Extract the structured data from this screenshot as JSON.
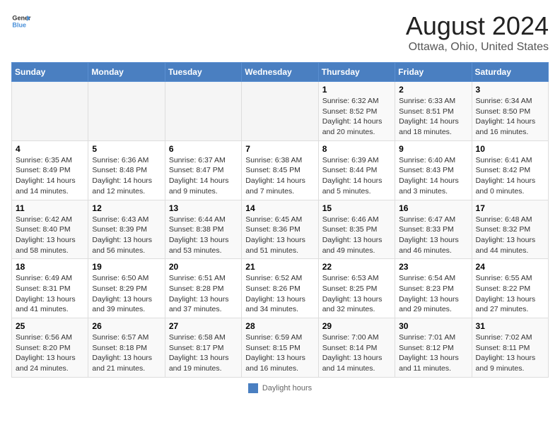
{
  "header": {
    "logo_line1": "General",
    "logo_line2": "Blue",
    "main_title": "August 2024",
    "subtitle": "Ottawa, Ohio, United States"
  },
  "days_of_week": [
    "Sunday",
    "Monday",
    "Tuesday",
    "Wednesday",
    "Thursday",
    "Friday",
    "Saturday"
  ],
  "weeks": [
    [
      {
        "date": "",
        "info": ""
      },
      {
        "date": "",
        "info": ""
      },
      {
        "date": "",
        "info": ""
      },
      {
        "date": "",
        "info": ""
      },
      {
        "date": "1",
        "info": "Sunrise: 6:32 AM\nSunset: 8:52 PM\nDaylight: 14 hours and 20 minutes."
      },
      {
        "date": "2",
        "info": "Sunrise: 6:33 AM\nSunset: 8:51 PM\nDaylight: 14 hours and 18 minutes."
      },
      {
        "date": "3",
        "info": "Sunrise: 6:34 AM\nSunset: 8:50 PM\nDaylight: 14 hours and 16 minutes."
      }
    ],
    [
      {
        "date": "4",
        "info": "Sunrise: 6:35 AM\nSunset: 8:49 PM\nDaylight: 14 hours and 14 minutes."
      },
      {
        "date": "5",
        "info": "Sunrise: 6:36 AM\nSunset: 8:48 PM\nDaylight: 14 hours and 12 minutes."
      },
      {
        "date": "6",
        "info": "Sunrise: 6:37 AM\nSunset: 8:47 PM\nDaylight: 14 hours and 9 minutes."
      },
      {
        "date": "7",
        "info": "Sunrise: 6:38 AM\nSunset: 8:45 PM\nDaylight: 14 hours and 7 minutes."
      },
      {
        "date": "8",
        "info": "Sunrise: 6:39 AM\nSunset: 8:44 PM\nDaylight: 14 hours and 5 minutes."
      },
      {
        "date": "9",
        "info": "Sunrise: 6:40 AM\nSunset: 8:43 PM\nDaylight: 14 hours and 3 minutes."
      },
      {
        "date": "10",
        "info": "Sunrise: 6:41 AM\nSunset: 8:42 PM\nDaylight: 14 hours and 0 minutes."
      }
    ],
    [
      {
        "date": "11",
        "info": "Sunrise: 6:42 AM\nSunset: 8:40 PM\nDaylight: 13 hours and 58 minutes."
      },
      {
        "date": "12",
        "info": "Sunrise: 6:43 AM\nSunset: 8:39 PM\nDaylight: 13 hours and 56 minutes."
      },
      {
        "date": "13",
        "info": "Sunrise: 6:44 AM\nSunset: 8:38 PM\nDaylight: 13 hours and 53 minutes."
      },
      {
        "date": "14",
        "info": "Sunrise: 6:45 AM\nSunset: 8:36 PM\nDaylight: 13 hours and 51 minutes."
      },
      {
        "date": "15",
        "info": "Sunrise: 6:46 AM\nSunset: 8:35 PM\nDaylight: 13 hours and 49 minutes."
      },
      {
        "date": "16",
        "info": "Sunrise: 6:47 AM\nSunset: 8:33 PM\nDaylight: 13 hours and 46 minutes."
      },
      {
        "date": "17",
        "info": "Sunrise: 6:48 AM\nSunset: 8:32 PM\nDaylight: 13 hours and 44 minutes."
      }
    ],
    [
      {
        "date": "18",
        "info": "Sunrise: 6:49 AM\nSunset: 8:31 PM\nDaylight: 13 hours and 41 minutes."
      },
      {
        "date": "19",
        "info": "Sunrise: 6:50 AM\nSunset: 8:29 PM\nDaylight: 13 hours and 39 minutes."
      },
      {
        "date": "20",
        "info": "Sunrise: 6:51 AM\nSunset: 8:28 PM\nDaylight: 13 hours and 37 minutes."
      },
      {
        "date": "21",
        "info": "Sunrise: 6:52 AM\nSunset: 8:26 PM\nDaylight: 13 hours and 34 minutes."
      },
      {
        "date": "22",
        "info": "Sunrise: 6:53 AM\nSunset: 8:25 PM\nDaylight: 13 hours and 32 minutes."
      },
      {
        "date": "23",
        "info": "Sunrise: 6:54 AM\nSunset: 8:23 PM\nDaylight: 13 hours and 29 minutes."
      },
      {
        "date": "24",
        "info": "Sunrise: 6:55 AM\nSunset: 8:22 PM\nDaylight: 13 hours and 27 minutes."
      }
    ],
    [
      {
        "date": "25",
        "info": "Sunrise: 6:56 AM\nSunset: 8:20 PM\nDaylight: 13 hours and 24 minutes."
      },
      {
        "date": "26",
        "info": "Sunrise: 6:57 AM\nSunset: 8:18 PM\nDaylight: 13 hours and 21 minutes."
      },
      {
        "date": "27",
        "info": "Sunrise: 6:58 AM\nSunset: 8:17 PM\nDaylight: 13 hours and 19 minutes."
      },
      {
        "date": "28",
        "info": "Sunrise: 6:59 AM\nSunset: 8:15 PM\nDaylight: 13 hours and 16 minutes."
      },
      {
        "date": "29",
        "info": "Sunrise: 7:00 AM\nSunset: 8:14 PM\nDaylight: 13 hours and 14 minutes."
      },
      {
        "date": "30",
        "info": "Sunrise: 7:01 AM\nSunset: 8:12 PM\nDaylight: 13 hours and 11 minutes."
      },
      {
        "date": "31",
        "info": "Sunrise: 7:02 AM\nSunset: 8:11 PM\nDaylight: 13 hours and 9 minutes."
      }
    ]
  ],
  "footer": {
    "daylight_hours_label": "Daylight hours"
  }
}
